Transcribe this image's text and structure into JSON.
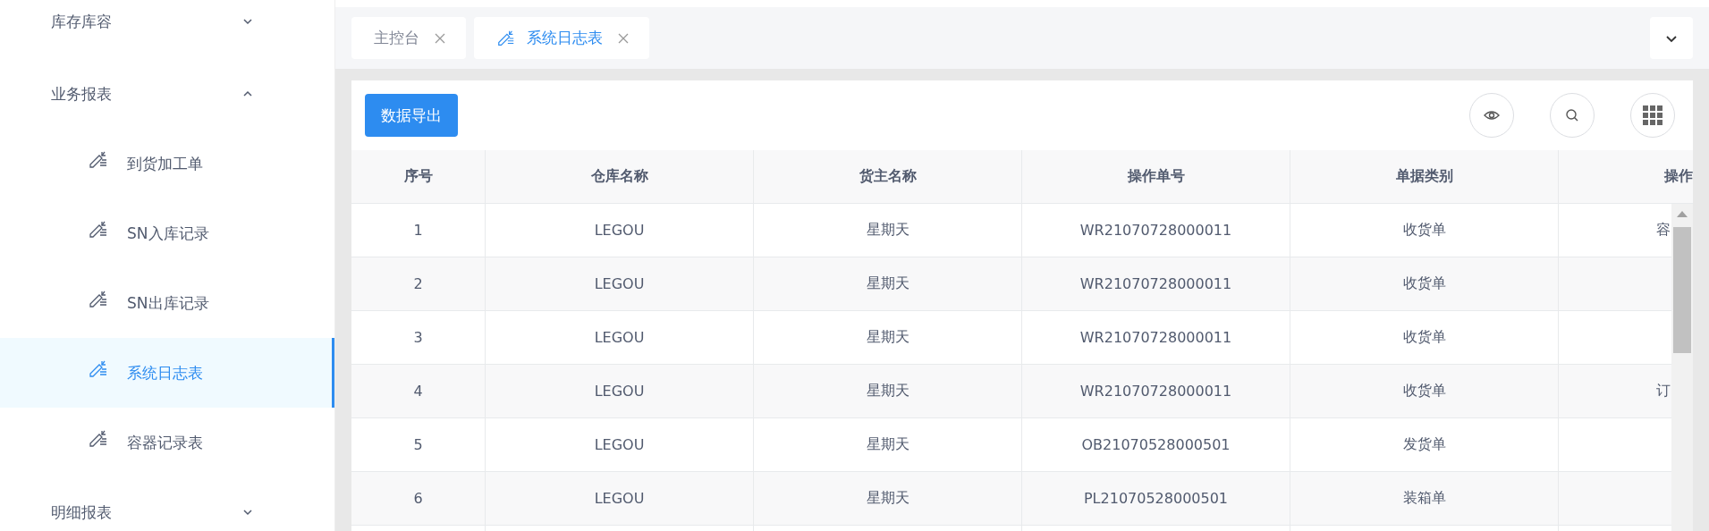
{
  "sidebar": {
    "groups": [
      {
        "label": "库存库容",
        "expanded": false
      },
      {
        "label": "业务报表",
        "expanded": true,
        "children": [
          {
            "label": "到货加工单",
            "selected": false
          },
          {
            "label": "SN入库记录",
            "selected": false
          },
          {
            "label": "SN出库记录",
            "selected": false
          },
          {
            "label": "系统日志表",
            "selected": true
          },
          {
            "label": "容器记录表",
            "selected": false
          }
        ]
      },
      {
        "label": "明细报表",
        "expanded": false
      }
    ]
  },
  "tabs": [
    {
      "label": "主控台",
      "selected": false,
      "has_icon": false
    },
    {
      "label": "系统日志表",
      "selected": true,
      "has_icon": true
    }
  ],
  "toolbar": {
    "export_button": "数据导出"
  },
  "table": {
    "columns": [
      "序号",
      "仓库名称",
      "货主名称",
      "操作单号",
      "单据类别",
      "操作"
    ],
    "rows": [
      {
        "cells": [
          "1",
          "LEGOU",
          "星期天",
          "WR21070728000011",
          "收货单"
        ],
        "operation": "容"
      },
      {
        "cells": [
          "2",
          "LEGOU",
          "星期天",
          "WR21070728000011",
          "收货单"
        ]
      },
      {
        "cells": [
          "3",
          "LEGOU",
          "星期天",
          "WR21070728000011",
          "收货单"
        ]
      },
      {
        "cells": [
          "4",
          "LEGOU",
          "星期天",
          "WR21070728000011",
          "收货单"
        ],
        "operation": "订"
      },
      {
        "cells": [
          "5",
          "LEGOU",
          "星期天",
          "OB21070528000501",
          "发货单"
        ]
      },
      {
        "cells": [
          "6",
          "LEGOU",
          "星期天",
          "PL21070528000501",
          "装箱单"
        ]
      }
    ]
  }
}
